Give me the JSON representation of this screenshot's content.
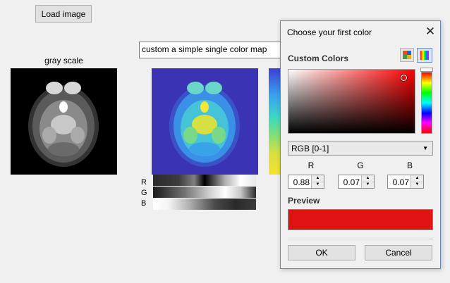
{
  "main": {
    "load_button": "Load image",
    "gray_title": "gray scale",
    "colormap_input_value": "custom a simple single color map",
    "rgb_labels": [
      "R",
      "G",
      "B"
    ]
  },
  "dialog": {
    "title": "Choose your first color",
    "custom_colors_label": "Custom Colors",
    "mode_option": "RGB [0-1]",
    "channels": [
      {
        "label": "R",
        "value": "0.88"
      },
      {
        "label": "G",
        "value": "0.07"
      },
      {
        "label": "B",
        "value": "0.07"
      }
    ],
    "preview_label": "Preview",
    "preview_color": "#e01212",
    "ok_label": "OK",
    "cancel_label": "Cancel"
  }
}
